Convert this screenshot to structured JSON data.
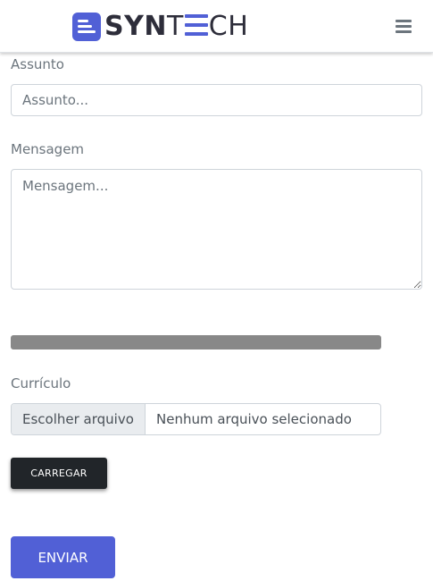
{
  "header": {
    "logo": {
      "part1": "SYN",
      "part2": "T",
      "part3": "CH",
      "brand_color": "#5160d6"
    },
    "menu_icon": "bars-icon"
  },
  "form": {
    "subject": {
      "label": "Assunto",
      "placeholder": "Assunto..."
    },
    "message": {
      "label": "Mensagem",
      "placeholder": "Mensagem..."
    },
    "upload_progress": {
      "value": 0
    },
    "resume": {
      "label": "Currículo",
      "choose_label": "Escolher arquivo",
      "status": "Nenhum arquivo selecionado"
    },
    "upload_button": "CARREGAR",
    "submit_button": "ENVIAR"
  }
}
